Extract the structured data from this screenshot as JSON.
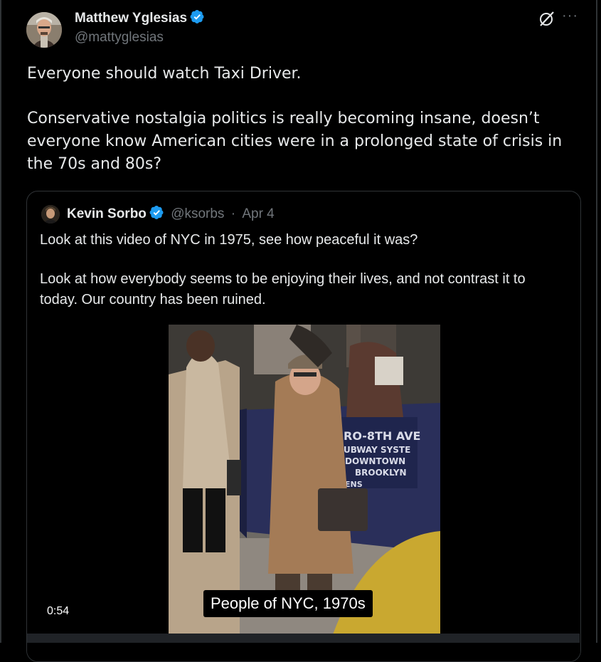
{
  "author": {
    "name": "Matthew Yglesias",
    "handle": "@mattyglesias",
    "verified_color": "#1d9bf0"
  },
  "tweet": {
    "paragraph_1": "Everyone should watch Taxi Driver.",
    "paragraph_2": "Conservative nostalgia politics is really becoming insane, doesn’t everyone know American cities were in a prolonged state of crisis in the 70s and 80s?"
  },
  "header_icons": [
    "grok-icon",
    "more-options-icon"
  ],
  "more_icon_glyph": "···",
  "quoted_tweet": {
    "name": "Kevin Sorbo",
    "handle": "@ksorbs",
    "separator": "·",
    "date": "Apr 4",
    "paragraph_1": "Look at this video of NYC in 1975, see how peaceful it was?",
    "paragraph_2": "Look at how everybody seems to be enjoying their lives, and not contrast it to today. Our country has been ruined.",
    "video": {
      "caption": "People of NYC, 1970s",
      "duration": "0:54",
      "sign_lines": [
        "RO-8TH AVE",
        "UBWAY SYSTE",
        "DOWNTOWN",
        "BROOKLYN",
        "ENS"
      ]
    }
  },
  "colors": {
    "background": "#000000",
    "text": "#e7e9ea",
    "muted": "#71767b",
    "border": "#2f3336",
    "accent": "#1d9bf0"
  }
}
